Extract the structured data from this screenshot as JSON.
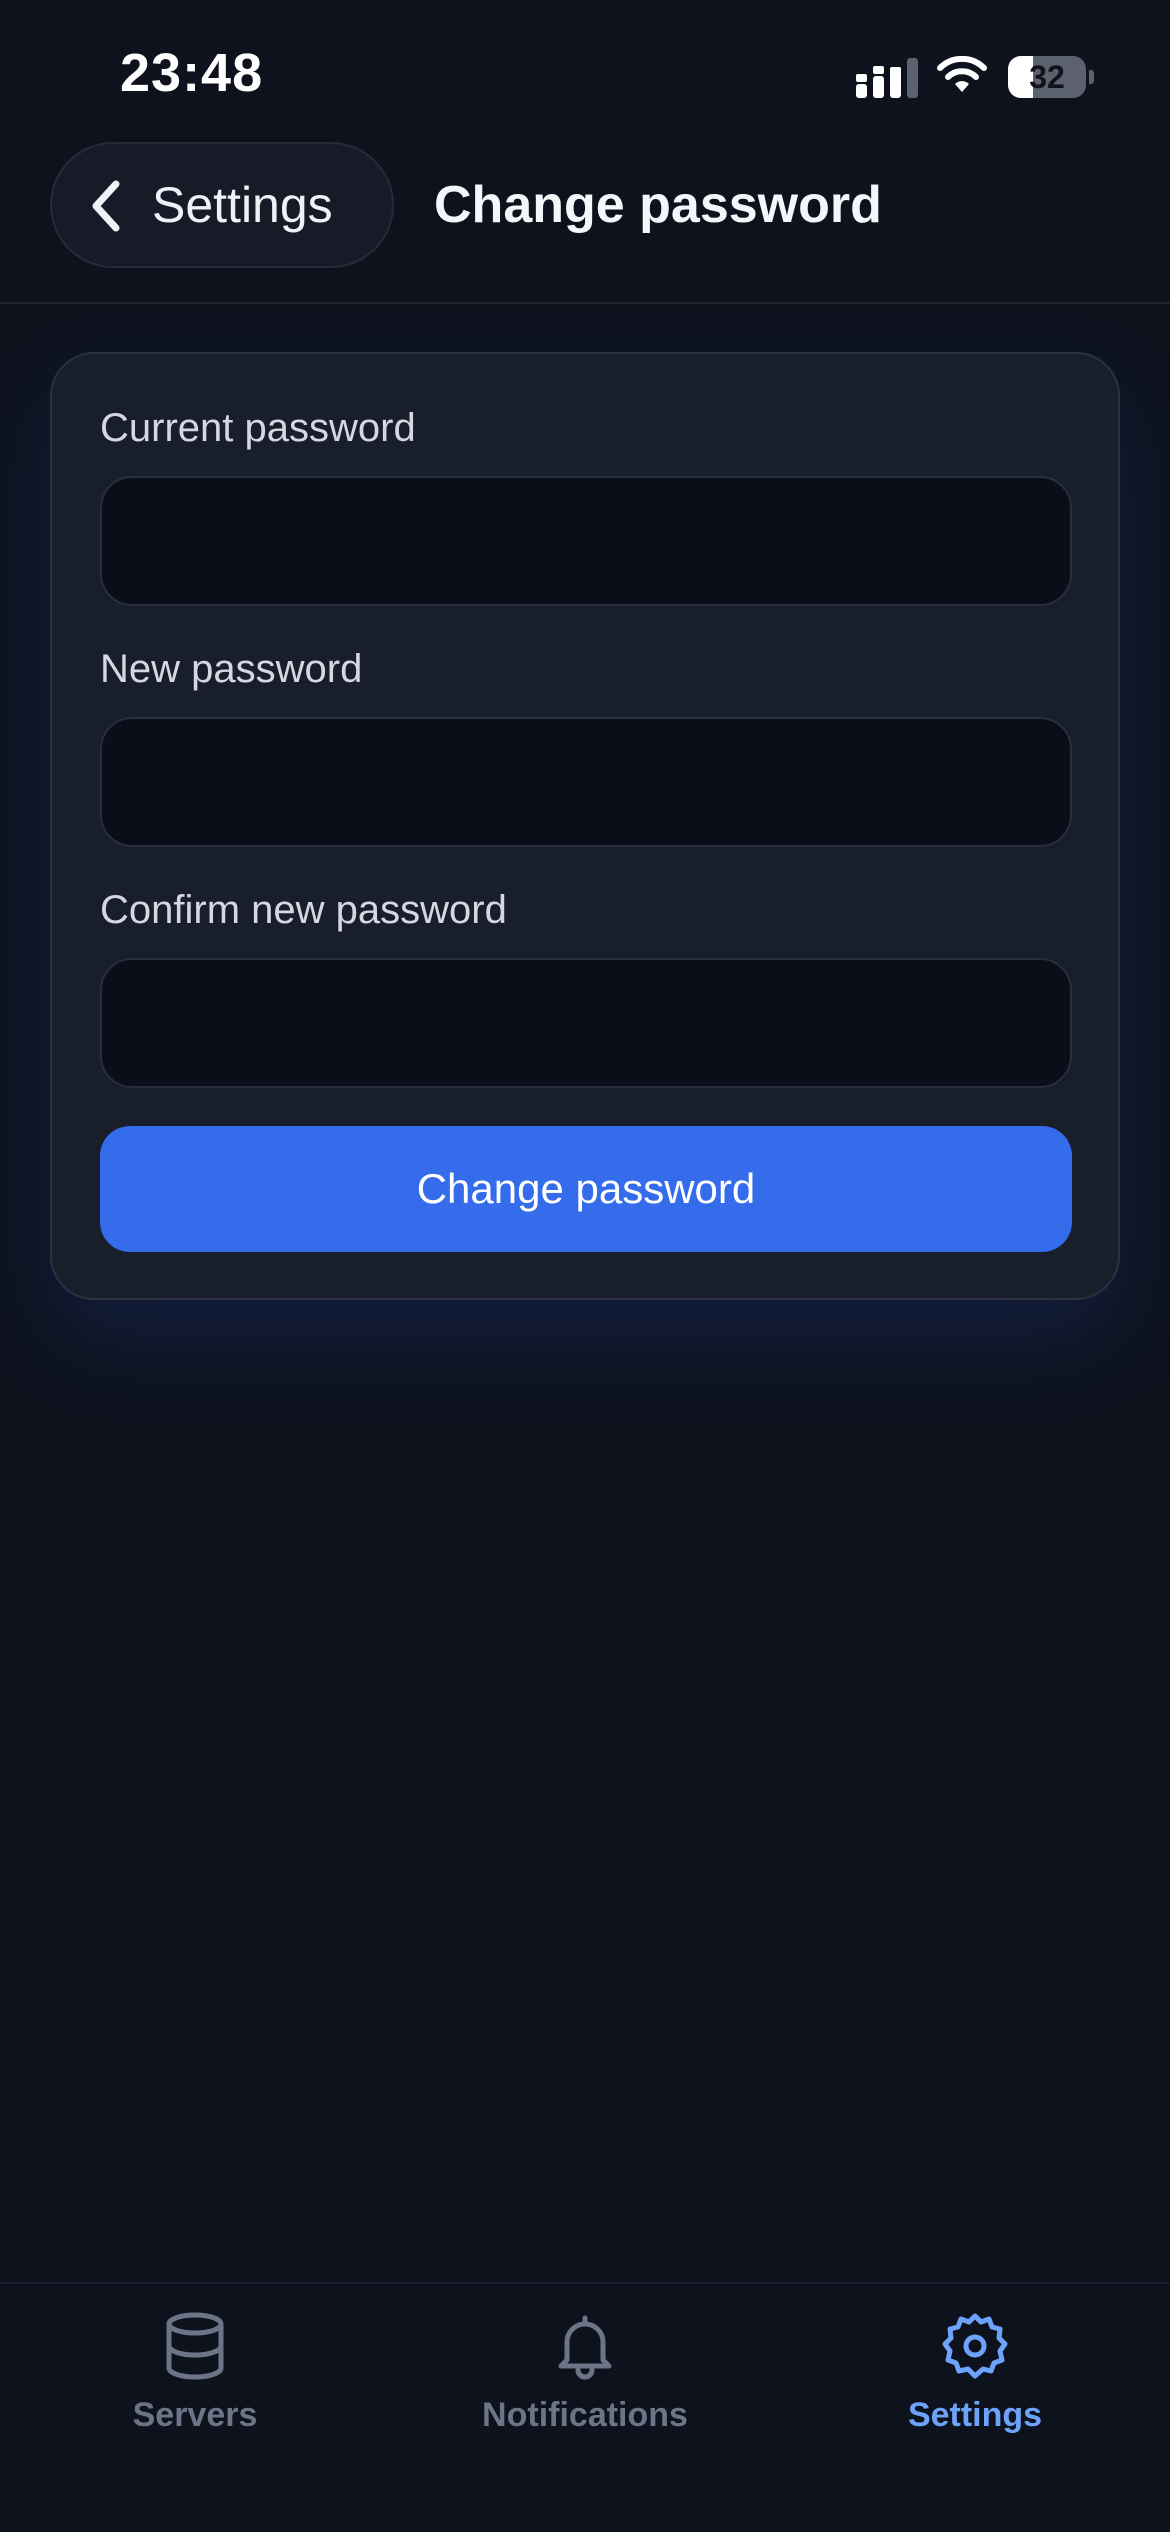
{
  "status_bar": {
    "time": "23:48",
    "battery_level": "32",
    "battery_fraction": 0.32,
    "icons": [
      "cellular-signal-icon",
      "wifi-icon",
      "battery-icon"
    ]
  },
  "header": {
    "back_label": "Settings",
    "title": "Change password",
    "back_icon": "chevron-left-icon"
  },
  "form": {
    "fields": [
      {
        "label": "Current password",
        "value": "",
        "placeholder": ""
      },
      {
        "label": "New password",
        "value": "",
        "placeholder": ""
      },
      {
        "label": "Confirm new password",
        "value": "",
        "placeholder": ""
      }
    ],
    "submit_label": "Change password"
  },
  "tab_bar": {
    "tabs": [
      {
        "label": "Servers",
        "icon": "database-icon",
        "active": false
      },
      {
        "label": "Notifications",
        "icon": "bell-icon",
        "active": false
      },
      {
        "label": "Settings",
        "icon": "gear-icon",
        "active": true
      }
    ]
  },
  "colors": {
    "background": "#0e121d",
    "card": "#191e2b",
    "input": "#0a0e18",
    "accent": "#346cec",
    "active_tab": "#6ea3fb",
    "inactive_tab": "#6c7588"
  }
}
